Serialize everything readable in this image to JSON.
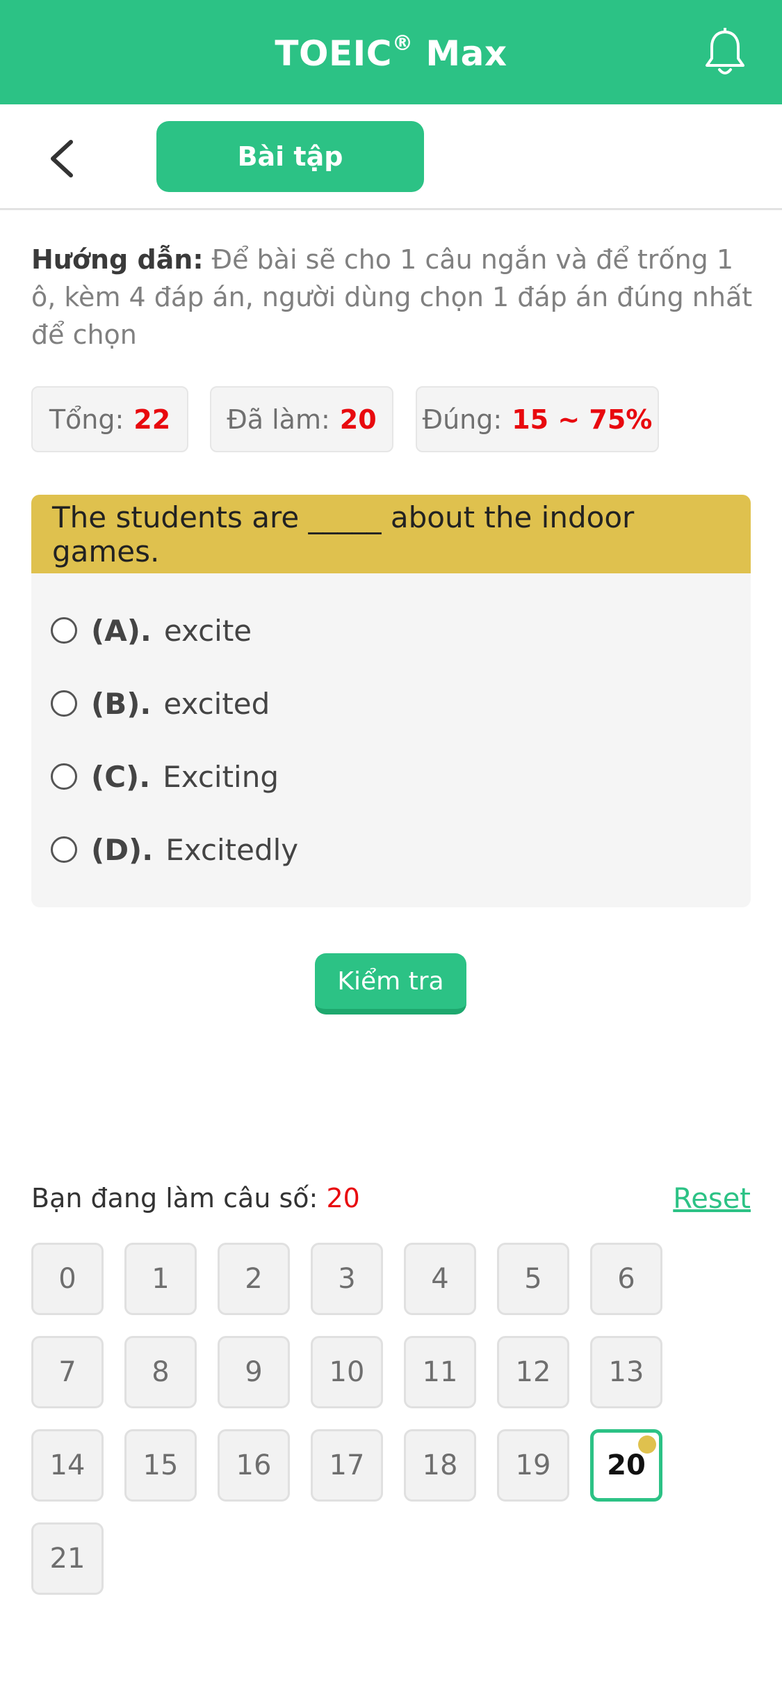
{
  "app": {
    "title": "TOEIC",
    "title_sup": "®",
    "title_suffix": " Max"
  },
  "subbar": {
    "tab_label": "Bài tập"
  },
  "instruction": {
    "label": "Hướng dẫn:",
    "text": " Để bài sẽ cho 1 câu ngắn và để trống 1 ô, kèm 4 đáp án, người dùng chọn 1 đáp án đúng nhất để chọn"
  },
  "stats": {
    "total_label": "Tổng:",
    "total_value": "22",
    "done_label": "Đã làm:",
    "done_value": "20",
    "correct_label": "Đúng:",
    "correct_value": "15 ~ 75%"
  },
  "question": {
    "text": "The students are _____ about the indoor games.",
    "options": [
      {
        "key": "(A).",
        "text": "excite"
      },
      {
        "key": "(B).",
        "text": "excited"
      },
      {
        "key": "(C).",
        "text": "Exciting"
      },
      {
        "key": "(D).",
        "text": "Excitedly"
      }
    ]
  },
  "check_button": "Kiểm tra",
  "progress": {
    "current_label": "Bạn đang làm câu số:",
    "current_value": "20",
    "reset_label": "Reset",
    "questions": [
      "0",
      "1",
      "2",
      "3",
      "4",
      "5",
      "6",
      "7",
      "8",
      "9",
      "10",
      "11",
      "12",
      "13",
      "14",
      "15",
      "16",
      "17",
      "18",
      "19",
      "20",
      "21"
    ],
    "active_index": 20
  },
  "colors": {
    "primary": "#2cc285",
    "question_header": "#dfc14e",
    "highlight_red": "#e8090e"
  },
  "icons": {
    "notification": "bell-icon",
    "back": "chevron-left-icon",
    "radio": "radio-unchecked-icon"
  }
}
